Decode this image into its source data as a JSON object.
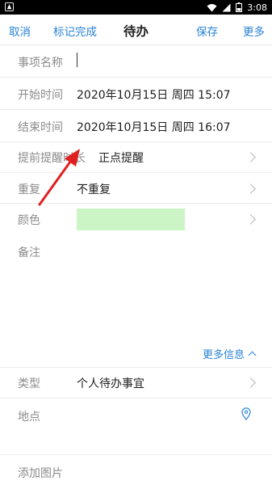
{
  "status_bar": {
    "time": "3:08",
    "icons": [
      "notification-icon",
      "wifi-icon",
      "signal-icon",
      "battery-icon"
    ]
  },
  "header": {
    "cancel_label": "取消",
    "mark_done_label": "标记完成",
    "title": "待办",
    "save_label": "保存",
    "more_label": "更多"
  },
  "form": {
    "item_name": {
      "label": "事项名称",
      "value": ""
    },
    "start_time": {
      "label": "开始时间",
      "value": "2020年10月15日 周四 15:07"
    },
    "end_time": {
      "label": "结束时间",
      "value": "2020年10月15日 周四 16:07"
    },
    "reminder": {
      "label": "提前提醒时长",
      "value": "正点提醒"
    },
    "repeat": {
      "label": "重复",
      "value": "不重复"
    },
    "color": {
      "label": "颜色",
      "swatch": "#ccf5c6"
    },
    "notes": {
      "label": "备注"
    },
    "more_info_label": "更多信息",
    "type": {
      "label": "类型",
      "value": "个人待办事宜"
    },
    "location": {
      "label": "地点",
      "value": ""
    },
    "add_image": {
      "label": "添加图片"
    }
  },
  "colors": {
    "accent": "#2a83d6",
    "annotation_arrow": "#e02020"
  }
}
